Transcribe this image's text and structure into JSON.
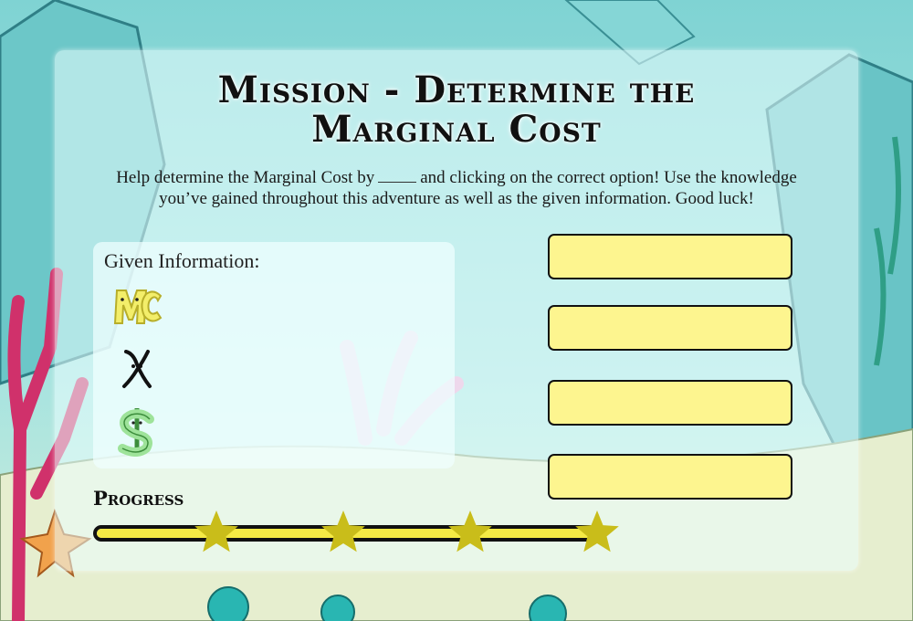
{
  "title": {
    "line1": "Mission - Determine the",
    "line2": "Marginal Cost"
  },
  "intro": {
    "before_blank": "Help determine the Marginal Cost by",
    "after_blank": "and clicking on the correct option! Use the knowledge you’ve gained throughout this adventure as well as the given information. Good luck!"
  },
  "given": {
    "heading": "Given Information:",
    "symbols": [
      "mc-letters-icon",
      "x-letter-icon",
      "dollar-sign-icon"
    ]
  },
  "options": [
    "",
    "",
    "",
    ""
  ],
  "progress": {
    "label": "Progress",
    "fraction": 1.0,
    "stars_total": 4,
    "stars_earned": 4
  },
  "colors": {
    "option_fill": "#fdf58f",
    "bar_fill": "#f5ea45",
    "star": "#c9bd1a",
    "mc_icon": "#f3ee6a",
    "dollar_icon": "#9ee39a"
  }
}
